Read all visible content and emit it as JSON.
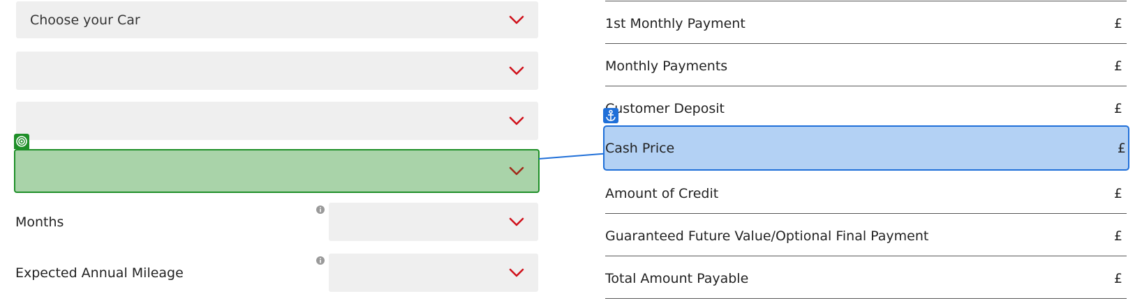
{
  "left_form": {
    "car_select": {
      "value": "Choose your Car"
    },
    "select_2": {
      "value": ""
    },
    "select_3": {
      "value": ""
    },
    "select_4": {
      "value": ""
    },
    "months": {
      "label": "Months",
      "value": ""
    },
    "mileage": {
      "label": "Expected Annual Mileage",
      "value": ""
    }
  },
  "summary": {
    "currency_symbol": "£",
    "rows": [
      {
        "label": "1st Monthly Payment"
      },
      {
        "label": "Monthly Payments"
      },
      {
        "label": "Customer Deposit"
      },
      {
        "label": "Cash Price"
      },
      {
        "label": "Amount of Credit"
      },
      {
        "label": "Guaranteed Future Value/Optional Final Payment"
      },
      {
        "label": "Total Amount Payable"
      }
    ]
  },
  "colors": {
    "chevron": "#d0111b",
    "highlight_green": "#1e8f28",
    "highlight_blue": "#1f6fd8"
  },
  "icons": {
    "chevron": "chevron-down-icon",
    "info": "info-icon",
    "target": "target-icon",
    "anchor": "anchor-icon"
  }
}
